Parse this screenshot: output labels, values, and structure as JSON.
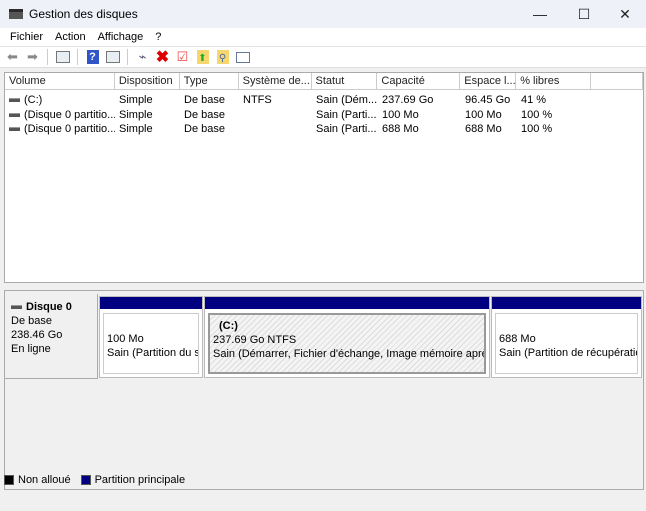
{
  "window": {
    "title": "Gestion des disques",
    "minimize": "—",
    "maximize": "☐",
    "close": "✕"
  },
  "menu": [
    "Fichier",
    "Action",
    "Affichage",
    "?"
  ],
  "toolbar": [
    "back",
    "forward",
    "console-tree",
    "help",
    "properties",
    "connect-disk",
    "delete",
    "check",
    "up-folder",
    "search",
    "settings"
  ],
  "columns": [
    "Volume",
    "Disposition",
    "Type",
    "Système de...",
    "Statut",
    "Capacité",
    "Espace l...",
    "% libres",
    ""
  ],
  "rows": [
    [
      "(C:)",
      "Simple",
      "De base",
      "NTFS",
      "Sain (Dém...",
      "237.69 Go",
      "96.45 Go",
      "41 %"
    ],
    [
      "(Disque 0 partitio...",
      "Simple",
      "De base",
      "",
      "Sain (Parti...",
      "100 Mo",
      "100 Mo",
      "100 %"
    ],
    [
      "(Disque 0 partitio...",
      "Simple",
      "De base",
      "",
      "Sain (Parti...",
      "688 Mo",
      "688 Mo",
      "100 %"
    ]
  ],
  "disk": {
    "name": "Disque 0",
    "type": "De base",
    "size": "238.46 Go",
    "status": "En ligne"
  },
  "partitions": [
    {
      "label": "",
      "size": "100 Mo",
      "status": "Sain (Partition du système EFI)"
    },
    {
      "label": "(C:)",
      "size": "237.69 Go NTFS",
      "status": "Sain (Démarrer, Fichier d'échange, Image mémoire après incident, Partition de données de base)"
    },
    {
      "label": "",
      "size": "688 Mo",
      "status": "Sain (Partition de récupération)"
    }
  ],
  "legend": [
    {
      "label": "Non alloué",
      "color": "#000000"
    },
    {
      "label": "Partition principale",
      "color": "#000080"
    }
  ]
}
